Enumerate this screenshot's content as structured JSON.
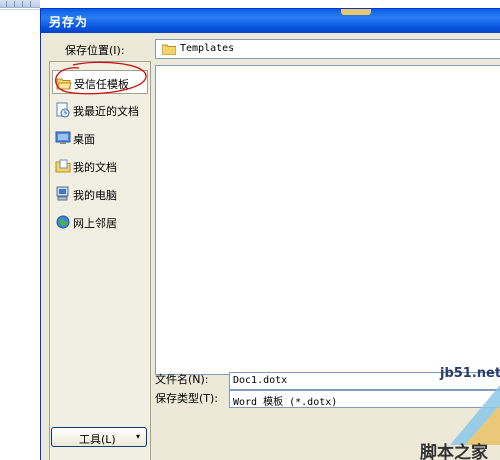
{
  "dialog": {
    "title": "另存为",
    "save_location_label": "保存位置(I):",
    "current_folder": "Templates"
  },
  "places": [
    {
      "label": "受信任模板",
      "icon": "folder-open-icon",
      "selected": true
    },
    {
      "label": "我最近的文档",
      "icon": "recent-documents-icon",
      "selected": false
    },
    {
      "label": "桌面",
      "icon": "desktop-icon",
      "selected": false
    },
    {
      "label": "我的文档",
      "icon": "my-documents-icon",
      "selected": false
    },
    {
      "label": "我的电脑",
      "icon": "my-computer-icon",
      "selected": false
    },
    {
      "label": "网上邻居",
      "icon": "network-places-icon",
      "selected": false
    }
  ],
  "filename": {
    "label": "文件名(N):",
    "value": "Doc1.dotx"
  },
  "filetype": {
    "label": "保存类型(T):",
    "value": "Word 模板 (*.dotx)"
  },
  "tools_button": {
    "label": "工具(L)"
  },
  "watermark": {
    "site": "jb51.net",
    "text": "脚本之家"
  },
  "colors": {
    "titlebar": "#0a5fe2",
    "dialog_bg": "#ece9d8",
    "annotation_circle": "#cc1111"
  }
}
